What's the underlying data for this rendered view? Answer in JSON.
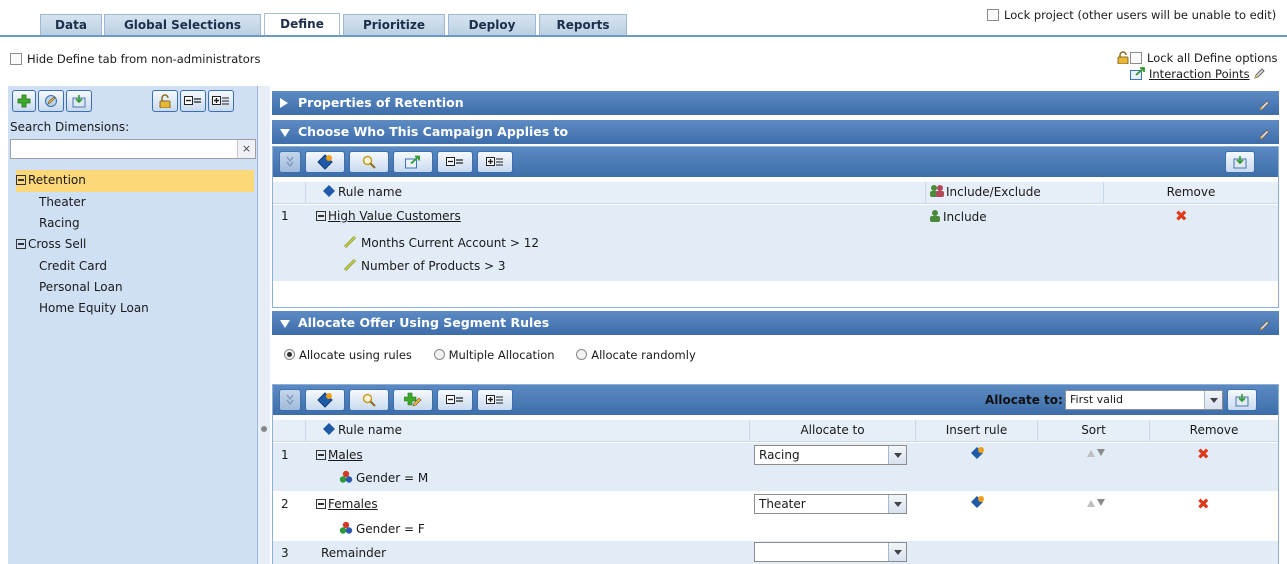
{
  "tabs": [
    "Data",
    "Global Selections",
    "Define",
    "Prioritize",
    "Deploy",
    "Reports"
  ],
  "active_tab": "Define",
  "lock_project_label": "Lock project (other users will be unable to edit)",
  "hide_define_label": "Hide Define tab from non-administrators",
  "lock_all_label": "Lock all Define options",
  "interaction_points_label": "Interaction Points",
  "left": {
    "search_label": "Search Dimensions:",
    "search_value": "",
    "clear_label": "×",
    "tree": {
      "retention": "Retention",
      "theater": "Theater",
      "racing": "Racing",
      "cross_sell": "Cross Sell",
      "credit_card": "Credit Card",
      "personal_loan": "Personal Loan",
      "home_equity_loan": "Home Equity Loan"
    }
  },
  "sections": {
    "properties": "Properties of Retention",
    "choose": "Choose Who This Campaign Applies to",
    "allocate": "Allocate Offer Using Segment Rules"
  },
  "choose_grid": {
    "headers": {
      "rule_name": "Rule name",
      "include_exclude": "Include/Exclude",
      "remove": "Remove"
    },
    "row_num": "1",
    "rule": "High Value Customers",
    "conditions": [
      "Months Current Account > 12",
      "Number of Products > 3"
    ],
    "include": "Include"
  },
  "allocation_options": {
    "using_rules": "Allocate using rules",
    "multiple": "Multiple Allocation",
    "randomly": "Allocate randomly",
    "selected": "using_rules"
  },
  "allocate_grid": {
    "allocate_to_label": "Allocate to:",
    "allocate_to_value": "First valid",
    "headers": {
      "rule_name": "Rule name",
      "allocate_to": "Allocate to",
      "insert_rule": "Insert rule",
      "sort": "Sort",
      "remove": "Remove"
    },
    "rows": [
      {
        "num": "1",
        "name": "Males",
        "condition": "Gender = M",
        "allocate": "Racing"
      },
      {
        "num": "2",
        "name": "Females",
        "condition": "Gender = F",
        "allocate": "Theater"
      },
      {
        "num": "3",
        "name": "Remainder",
        "allocate": ""
      }
    ]
  },
  "colors": {
    "accent": "#3d6daa",
    "tab_active": "#ffffff",
    "selected_tree": "#fcd77a",
    "remove": "#e0391a"
  }
}
